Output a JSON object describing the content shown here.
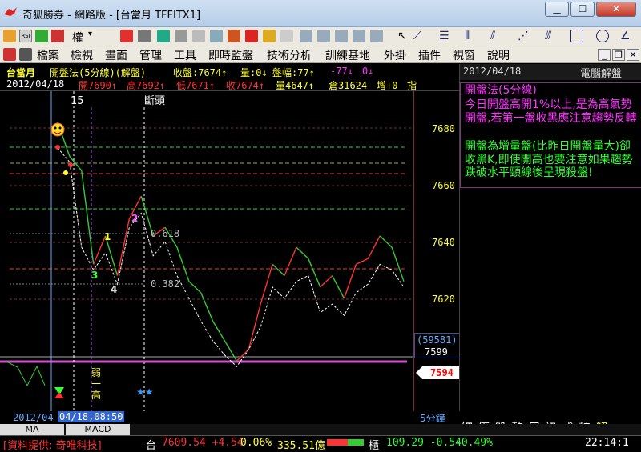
{
  "window": {
    "title": "奇狐勝券 - 網路版 - [台當月 TFFITX1]"
  },
  "menu": [
    "檔案",
    "檢視",
    "畫面",
    "管理",
    "工具",
    "即時監盤",
    "技術分析",
    "訓練基地",
    "外掛",
    "插件",
    "視窗",
    "說明"
  ],
  "toolbar": {
    "mode_label": "權"
  },
  "info": {
    "symbol": "台當月",
    "strategy": "開盤法(5分線)(解盤)",
    "close_label": "收盤:7674↑",
    "vol_label": "量:0↓",
    "range_label": "盤幅:77↑",
    "chg_label": "-77↓",
    "extra": "0↓",
    "date": "2012/04/18",
    "open": "開7690↑",
    "high": "高7692↑",
    "low": "低7671↑",
    "close": "收7674↑",
    "volume": "量4647↑",
    "oi": "倉31624",
    "oi_chg": "增+0",
    "tail": "指"
  },
  "chart": {
    "marker_15": "15",
    "marker_break": "斷頭",
    "fib_618": "0.618",
    "fib_382": "0.382",
    "wave_1": "1",
    "wave_2": "2",
    "wave_3": "3",
    "wave_4": "4",
    "weak_high": [
      "弱",
      "一",
      "高"
    ],
    "stars": "★★",
    "y_ticks": [
      "7680",
      "7660",
      "7640",
      "7620"
    ],
    "volume_box": "(59581)",
    "price_box": "7599",
    "last_price": "7594"
  },
  "chart_data": {
    "type": "line",
    "series": [
      {
        "values": [
          7682,
          7670,
          7665,
          7632,
          7642,
          7628,
          7648,
          7656,
          7642,
          7645,
          7638,
          7626,
          7622,
          7612,
          7605,
          7598,
          7602,
          7618,
          7632,
          7628,
          7638,
          7634,
          7624,
          7628,
          7620,
          7632,
          7634,
          7642,
          7638,
          7626
        ]
      },
      {
        "values": [
          7673,
          7668,
          7638,
          7630,
          7636,
          7625,
          7645,
          7650,
          7635,
          7640,
          7628,
          7620,
          7612,
          7605,
          7600,
          7596,
          7602,
          7610,
          7624,
          7620,
          7626,
          7628,
          7615,
          7618,
          7614,
          7622,
          7625,
          7632,
          7630,
          7624
        ]
      }
    ]
  },
  "right_panel": {
    "date": "2012/04/18",
    "title": "電腦解盤",
    "heading": "開盤法(5分線)",
    "para1": "今日開盤高開1%以上,是為高氣勢開盤,若第一盤收黑應注意趨勢反轉",
    "para2": "開盤為增量盤(比昨日開盤量大)卻收黑K,即使開高也要注意如果趨勢跌破水平頸線後呈現殺盤!",
    "buttons": [
      "細",
      "價",
      "盤",
      "勢",
      "周",
      "訊",
      "成",
      "特",
      "解"
    ]
  },
  "bottom": {
    "date_left": "2012/04",
    "date_cursor": "04/18,08:50",
    "ma": "MA",
    "macd": "MACD",
    "period": "5分鐘"
  },
  "status": {
    "source": "[資料提供: 奇唯科技]",
    "index_name": "台",
    "index_val": "7609.54 +4.54",
    "pct": "0.06%",
    "amount": "335.51億",
    "otc_name": "櫃",
    "otc_val": "109.29 -0.54",
    "otc_pct": "-0.49%",
    "time": "22:14:1"
  },
  "colors": {
    "up": "#ff3333",
    "down": "#33cc33",
    "text_magenta": "#ff33ff",
    "text_green": "#33ff33",
    "yellow": "#ffff33"
  }
}
